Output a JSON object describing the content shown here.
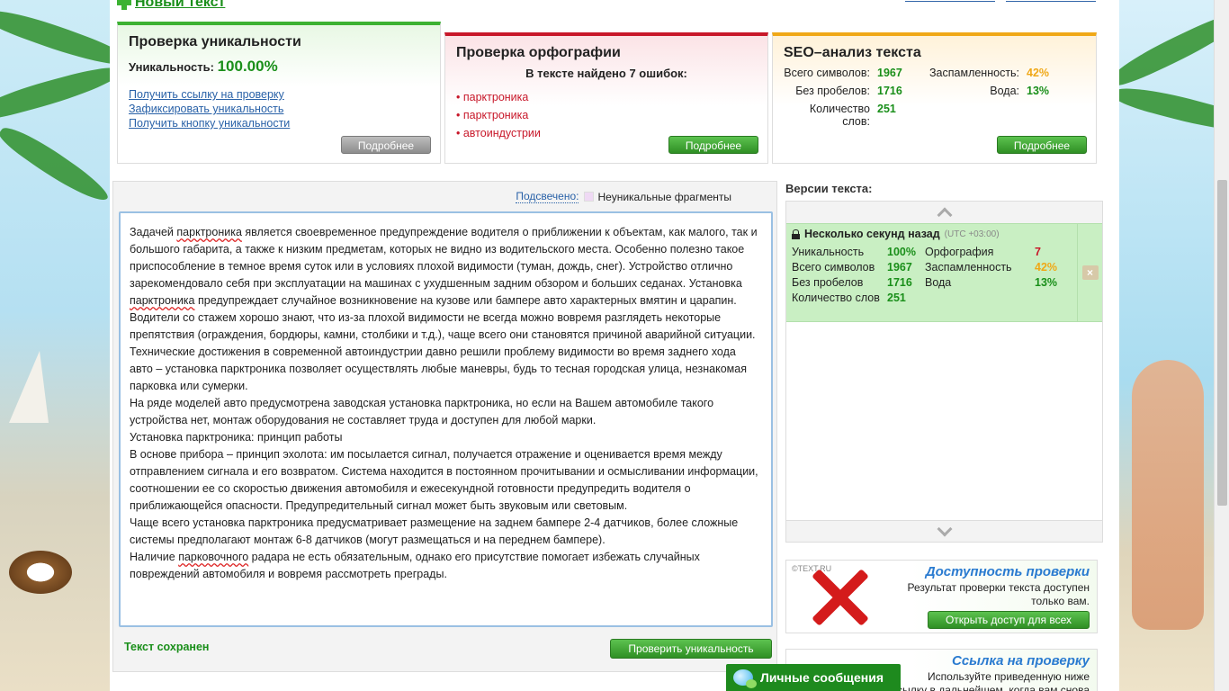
{
  "header": {
    "new_text": "Новый текст"
  },
  "uniqueness_card": {
    "title": "Проверка уникальности",
    "label": "Уникальность:",
    "value": "100.00%",
    "links": [
      "Получить ссылку на проверку",
      "Зафиксировать уникальность",
      "Получить кнопку уникальности"
    ],
    "more": "Подробнее"
  },
  "spelling_card": {
    "title": "Проверка орфографии",
    "subtitle": "В тексте найдено 7 ошибок:",
    "errors": [
      "парктроника",
      "парктроника",
      "автоиндустрии"
    ],
    "more": "Подробнее"
  },
  "seo_card": {
    "title": "SEO–анализ текста",
    "total_label": "Всего символов:",
    "total_value": "1967",
    "spam_label": "Заспамленность:",
    "spam_value": "42%",
    "nospace_label": "Без пробелов:",
    "nospace_value": "1716",
    "water_label": "Вода:",
    "water_value": "13%",
    "words_label": "Количество слов:",
    "words_value": "251",
    "more": "Подробнее"
  },
  "editor": {
    "highlighted_label": "Подсвечено:",
    "legend_label": "Неуникальные фрагменты",
    "paragraphs": [
      [
        "Задачей ",
        "парктроника",
        " является своевременное предупреждение водителя о приближении к объектам, как малого, так и большого габарита, а также к низким предметам, которых не видно из водительского места. Особенно полезно такое приспособление в темное время суток или в условиях плохой видимости (туман, дождь, снег). Устройство отлично зарекомендовало себя при эксплуатации на машинах с ухудшенным задним обзором и больших седанах. Установка ",
        "парктроника",
        " предупреждает случайное возникновение на кузове или бампере авто характерных вмятин и царапин."
      ],
      [
        "Водители со стажем хорошо знают, что из-за плохой видимости не всегда можно вовремя разглядеть некоторые препятствия (ограждения, бордюры, камни, столбики и т.д.), чаще всего они становятся причиной аварийной ситуации."
      ],
      [
        "Технические достижения в современной автоиндустрии давно решили проблему видимости во время заднего хода авто – установка парктроника позволяет осуществлять любые маневры, будь то тесная городская улица, незнакомая парковка или сумерки."
      ],
      [
        "На ряде моделей авто предусмотрена заводская установка парктроника, но если на Вашем автомобиле такого устройства нет, монтаж оборудования не составляет труда и доступен для любой марки."
      ],
      [
        "Установка парктроника: принцип работы"
      ],
      [
        "В основе прибора – принцип эхолота: им посылается сигнал, получается отражение и оценивается время между отправлением сигнала и его возвратом. Система находится в постоянном прочитывании и осмысливании информации, соотношении ее со скоростью движения автомобиля и ежесекундной готовности предупредить водителя о приближающейся опасности. Предупредительный сигнал может быть звуковым или световым."
      ],
      [
        "Чаще всего установка парктроника предусматривает размещение на заднем бампере 2-4 датчиков, более сложные системы предполагают монтаж 6-8 датчиков (могут размещаться и на переднем бампере)."
      ],
      [
        "Наличие ",
        "парковочного",
        " радара не есть обязательным, однако его присутствие помогает избежать случайных повреждений автомобиля и вовремя рассмотреть преграды."
      ]
    ],
    "saved": "Текст сохранен",
    "check_button": "Проверить уникальность"
  },
  "versions": {
    "title": "Версии текста:",
    "entry": {
      "time": "Несколько секунд назад",
      "tz": "(UTC +03:00)",
      "uniq_label": "Уникальность",
      "uniq_value": "100%",
      "spell_label": "Орфография",
      "spell_value": "7",
      "total_label": "Всего символов",
      "total_value": "1967",
      "spam_label": "Заспамленность",
      "spam_value": "42%",
      "nospace_label": "Без пробелов",
      "nospace_value": "1716",
      "water_label": "Вода",
      "water_value": "13%",
      "words_label": "Количество слов",
      "words_value": "251",
      "delete": "×"
    }
  },
  "promo_access": {
    "logo": "©TEXT.RU",
    "title": "Доступность проверки",
    "text": "Результат проверки текста доступен только вам.",
    "button": "Открыть доступ для всех"
  },
  "promo_link": {
    "title": "Ссылка на проверку",
    "text": "Используйте приведенную ниже ссылку в дальнейшем, когда вам снова"
  },
  "messages": {
    "label": "Личные сообщения"
  },
  "colors": {
    "green": "#1a8f1a",
    "red": "#c8182a",
    "orange": "#f0a817",
    "link": "#2a62a8"
  }
}
